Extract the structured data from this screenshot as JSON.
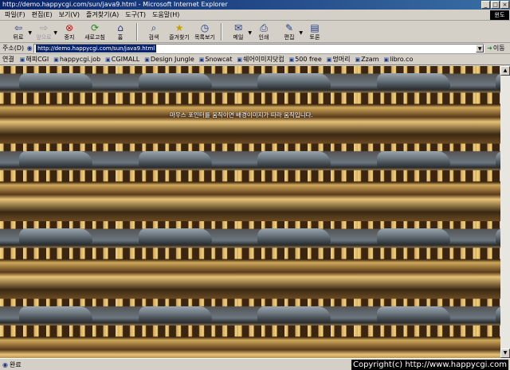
{
  "window": {
    "title": "http://demo.happycgi.com/sun/java9.html - Microsoft Internet Explorer",
    "controls": [
      "_",
      "□",
      "×"
    ]
  },
  "menubar": {
    "items": [
      "파일(F)",
      "편집(E)",
      "보기(V)",
      "즐겨찾기(A)",
      "도구(T)",
      "도움말(H)"
    ],
    "logo": "윈도"
  },
  "toolbar": {
    "back": "뒤로",
    "forward": "앞으로",
    "stop": "중지",
    "refresh": "새로고침",
    "home": "홈",
    "search": "검색",
    "favorites": "즐겨찾기",
    "history": "목록보기",
    "mail": "메일",
    "print": "인쇄",
    "edit": "편집",
    "discuss": "토론"
  },
  "addressbar": {
    "label": "주소(D)",
    "url": "http://demo.happycgi.com/sun/java9.html",
    "go": "이동"
  },
  "linksbar": {
    "label": "연결",
    "items": [
      "해피CGI",
      "happycgi.job",
      "CGIMALL",
      "Design Jungle",
      "Snowcat",
      "쉐어이미지닷컴",
      "500 free",
      "멍머리",
      "Zzam",
      "libro.co"
    ]
  },
  "content": {
    "message": "마우스 포인터를 움직이면 배경이미지가 따라 움직입니다."
  },
  "statusbar": {
    "text": "완료",
    "copyright": "Copyright(c) http://www.happycgi.com"
  },
  "colors": {
    "titlebar": "#0a246a",
    "chrome": "#d4d0c8",
    "arch_wall": "#e2b963"
  }
}
